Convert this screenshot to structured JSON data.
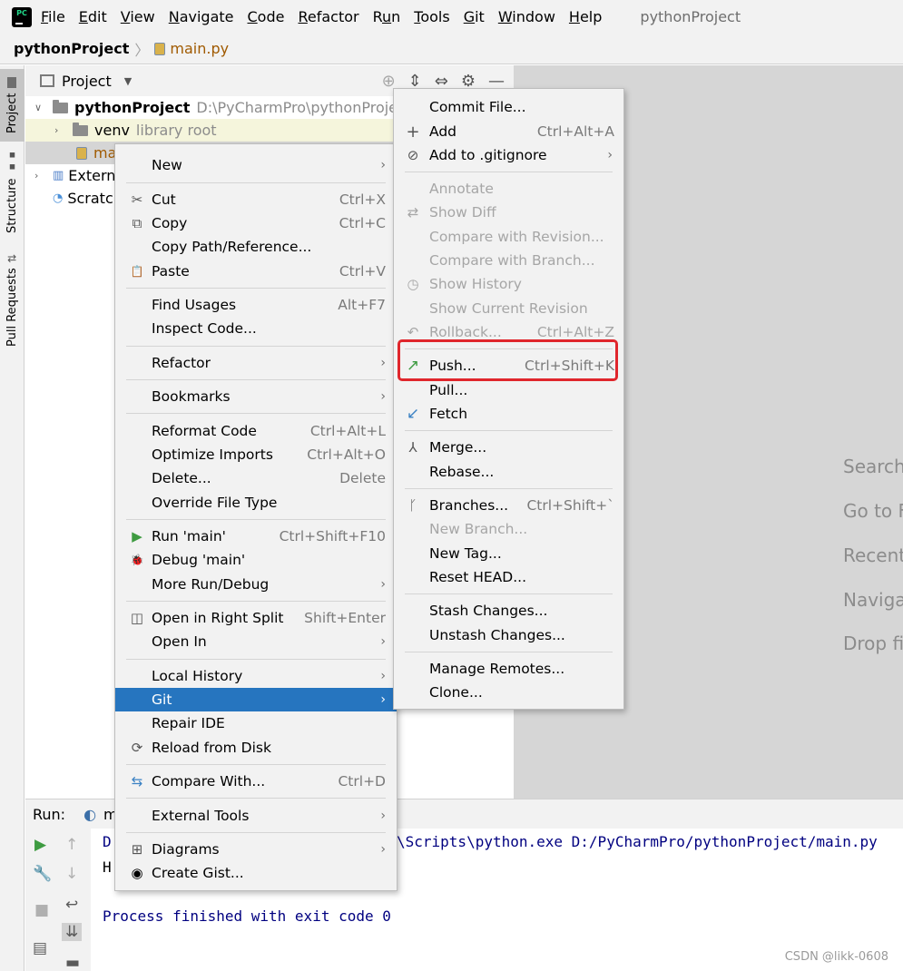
{
  "menubar": {
    "items": [
      {
        "pre": "",
        "u": "F",
        "post": "ile"
      },
      {
        "pre": "",
        "u": "E",
        "post": "dit"
      },
      {
        "pre": "",
        "u": "V",
        "post": "iew"
      },
      {
        "pre": "",
        "u": "N",
        "post": "avigate"
      },
      {
        "pre": "",
        "u": "C",
        "post": "ode"
      },
      {
        "pre": "",
        "u": "R",
        "post": "efactor"
      },
      {
        "pre": "R",
        "u": "u",
        "post": "n"
      },
      {
        "pre": "",
        "u": "T",
        "post": "ools"
      },
      {
        "pre": "",
        "u": "G",
        "post": "it"
      },
      {
        "pre": "",
        "u": "W",
        "post": "indow"
      },
      {
        "pre": "",
        "u": "H",
        "post": "elp"
      }
    ],
    "window_title": "pythonProject",
    "logo_text": "PC"
  },
  "breadcrumb": {
    "project": "pythonProject",
    "file": "main.py"
  },
  "left_strip": {
    "project": "Project",
    "structure": "Structure",
    "pull_requests": "Pull Requests"
  },
  "project_panel": {
    "header": "Project",
    "tree": [
      {
        "label": "pythonProject",
        "extra": "D:\\PyCharmPro\\pythonProject"
      },
      {
        "label": "venv",
        "extra": "library root"
      },
      {
        "label": "ma",
        "extra": ""
      },
      {
        "label": "Extern",
        "extra": ""
      },
      {
        "label": "Scratc",
        "extra": ""
      }
    ]
  },
  "editor_hints": [
    "Search",
    "Go to F",
    "Recent",
    "Naviga",
    "Drop fi"
  ],
  "run": {
    "label": "Run:",
    "tab_label": "m",
    "console": {
      "line1_prefix": "D",
      "line1_suffix": "\\Scripts\\python.exe D:/PyCharmPro/pythonProject/main.py",
      "line2": "H",
      "line3": "Process finished with exit code 0"
    }
  },
  "context_menu": {
    "items": [
      {
        "label": "New",
        "shortcut": "",
        "submenu": true
      },
      {
        "label": "Cut",
        "shortcut": "Ctrl+X",
        "icon": "✂"
      },
      {
        "label": "Copy",
        "shortcut": "Ctrl+C",
        "icon": "⧉"
      },
      {
        "label": "Copy Path/Reference...",
        "shortcut": ""
      },
      {
        "label": "Paste",
        "shortcut": "Ctrl+V",
        "icon": "📋"
      },
      {
        "label": "Find Usages",
        "shortcut": "Alt+F7"
      },
      {
        "label": "Inspect Code...",
        "shortcut": ""
      },
      {
        "label": "Refactor",
        "shortcut": "",
        "submenu": true
      },
      {
        "label": "Bookmarks",
        "shortcut": "",
        "submenu": true
      },
      {
        "label": "Reformat Code",
        "shortcut": "Ctrl+Alt+L"
      },
      {
        "label": "Optimize Imports",
        "shortcut": "Ctrl+Alt+O"
      },
      {
        "label": "Delete...",
        "shortcut": "Delete"
      },
      {
        "label": "Override File Type",
        "shortcut": ""
      },
      {
        "label": "Run 'main'",
        "shortcut": "Ctrl+Shift+F10",
        "icon": "▶"
      },
      {
        "label": "Debug 'main'",
        "shortcut": "",
        "icon": "🐞"
      },
      {
        "label": "More Run/Debug",
        "shortcut": "",
        "submenu": true
      },
      {
        "label": "Open in Right Split",
        "shortcut": "Shift+Enter",
        "icon": "◫"
      },
      {
        "label": "Open In",
        "shortcut": "",
        "submenu": true
      },
      {
        "label": "Local History",
        "shortcut": "",
        "submenu": true
      },
      {
        "label": "Git",
        "shortcut": "",
        "submenu": true
      },
      {
        "label": "Repair IDE",
        "shortcut": ""
      },
      {
        "label": "Reload from Disk",
        "shortcut": "",
        "icon": "⟳"
      },
      {
        "label": "Compare With...",
        "shortcut": "Ctrl+D",
        "icon": "⇆"
      },
      {
        "label": "External Tools",
        "shortcut": "",
        "submenu": true
      },
      {
        "label": "Diagrams",
        "shortcut": "",
        "submenu": true,
        "icon": "⊞"
      },
      {
        "label": "Create Gist...",
        "shortcut": "",
        "icon": "◉"
      }
    ]
  },
  "git_menu": {
    "items": [
      {
        "label": "Commit File...",
        "shortcut": ""
      },
      {
        "label": "Add",
        "shortcut": "Ctrl+Alt+A",
        "icon": "+"
      },
      {
        "label": "Add to .gitignore",
        "shortcut": "",
        "submenu": true,
        "icon": "⊘"
      },
      {
        "label": "Annotate",
        "shortcut": ""
      },
      {
        "label": "Show Diff",
        "shortcut": "",
        "icon": "⇄"
      },
      {
        "label": "Compare with Revision...",
        "shortcut": ""
      },
      {
        "label": "Compare with Branch...",
        "shortcut": ""
      },
      {
        "label": "Show History",
        "shortcut": "",
        "icon": "◷"
      },
      {
        "label": "Show Current Revision",
        "shortcut": ""
      },
      {
        "label": "Rollback...",
        "shortcut": "Ctrl+Alt+Z",
        "icon": "↶"
      },
      {
        "label": "Push...",
        "shortcut": "Ctrl+Shift+K",
        "icon": "↗"
      },
      {
        "label": "Pull...",
        "shortcut": ""
      },
      {
        "label": "Fetch",
        "shortcut": "",
        "icon": "↙"
      },
      {
        "label": "Merge...",
        "shortcut": "",
        "icon": "⅄"
      },
      {
        "label": "Rebase...",
        "shortcut": ""
      },
      {
        "label": "Branches...",
        "shortcut": "Ctrl+Shift+`",
        "icon": "ᚴ"
      },
      {
        "label": "New Branch...",
        "shortcut": ""
      },
      {
        "label": "New Tag...",
        "shortcut": ""
      },
      {
        "label": "Reset HEAD...",
        "shortcut": ""
      },
      {
        "label": "Stash Changes...",
        "shortcut": ""
      },
      {
        "label": "Unstash Changes...",
        "shortcut": ""
      },
      {
        "label": "Manage Remotes...",
        "shortcut": ""
      },
      {
        "label": "Clone...",
        "shortcut": ""
      }
    ]
  },
  "watermark": "CSDN @likk-0608",
  "colors": {
    "selection": "#2675bf",
    "highlight_box": "#e0262c",
    "run_green": "#3e9b41",
    "push_arrow": "#3e9b41",
    "fetch_arrow": "#3b82c4"
  }
}
